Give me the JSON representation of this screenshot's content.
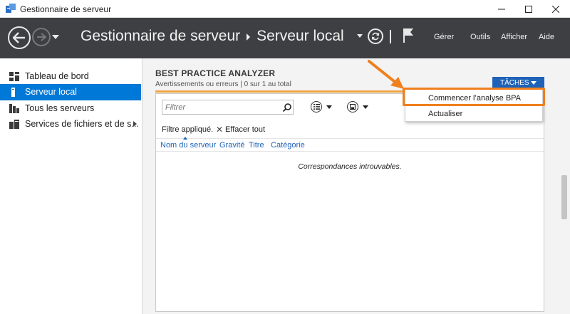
{
  "window": {
    "title": "Gestionnaire de serveur"
  },
  "header": {
    "breadcrumb_root": "Gestionnaire de serveur",
    "breadcrumb_current": "Serveur local",
    "menu": {
      "gerer": "Gérer",
      "outils": "Outils",
      "afficher": "Afficher",
      "aide": "Aide"
    }
  },
  "sidebar": {
    "items": [
      {
        "label": "Tableau de bord",
        "icon": "dashboard-icon",
        "active": false
      },
      {
        "label": "Serveur local",
        "icon": "server-icon",
        "active": true
      },
      {
        "label": "Tous les serveurs",
        "icon": "servers-icon",
        "active": false
      },
      {
        "label": "Services de fichiers et de s...",
        "icon": "file-services-icon",
        "active": false
      }
    ]
  },
  "bpa": {
    "title": "BEST PRACTICE ANALYZER",
    "subtitle": "Avertissements ou erreurs | 0 sur 1 au total",
    "tasks_label": "TÂCHES",
    "filter_placeholder": "Filtrer",
    "filter_applied": "Filtre appliqué.",
    "clear_all": "Effacer tout",
    "columns": [
      "Nom du serveur",
      "Gravité",
      "Titre",
      "Catégorie"
    ],
    "empty_message": "Correspondances introuvables."
  },
  "tasks_menu": {
    "items": [
      "Commencer l’analyse BPA",
      "Actualiser"
    ]
  },
  "colors": {
    "header_bg": "#3d3f42",
    "accent_blue": "#0078d7",
    "tasks_blue": "#1e63b8",
    "highlight_orange": "#f07f1e",
    "rule_orange": "#f0a542"
  }
}
